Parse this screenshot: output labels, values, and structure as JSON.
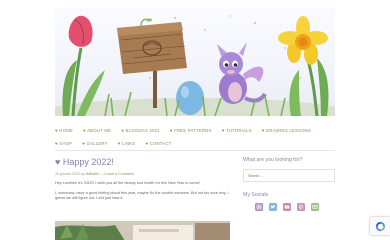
{
  "nav": {
    "heart": "♥",
    "row1": [
      "HOME",
      "ABOUT ME",
      "BLOGMAS 2021",
      "FREE PATTERNS",
      "TUTORIALS",
      "DRAWING LESSONS"
    ],
    "row2": [
      "SHOP",
      "GALLERY",
      "LINKS",
      "CONTACT"
    ]
  },
  "post": {
    "title": "♥ Happy 2022!",
    "date": "16 januari 2022 by",
    "author": "Nathalie",
    "separator": "—",
    "comment": "Leave a Comment",
    "p1": "Hey Lovelies It's 2022!! I wish you all the beauty and health for this New Year to come!",
    "p2": "I, somehow, have a good feeling about this year, maybe it's the double numbers. But not too sure why, I guess we will figure out. Let's just face it."
  },
  "sidebar": {
    "search_title": "What are you looking for?",
    "search_placeholder": "Search ...",
    "socials_title": "My Socials",
    "socials": [
      {
        "icon": "instagram-icon",
        "color": "#b38fc4"
      },
      {
        "icon": "twitter-icon",
        "color": "#8ab2d6"
      },
      {
        "icon": "youtube-icon",
        "color": "#c58fa8"
      },
      {
        "icon": "pinterest-icon",
        "color": "#c597b8"
      },
      {
        "icon": "email-icon",
        "color": "#9dc08b"
      }
    ]
  },
  "colors": {
    "accent_green": "#7a9a57",
    "accent_purple": "#8a7fb0"
  }
}
